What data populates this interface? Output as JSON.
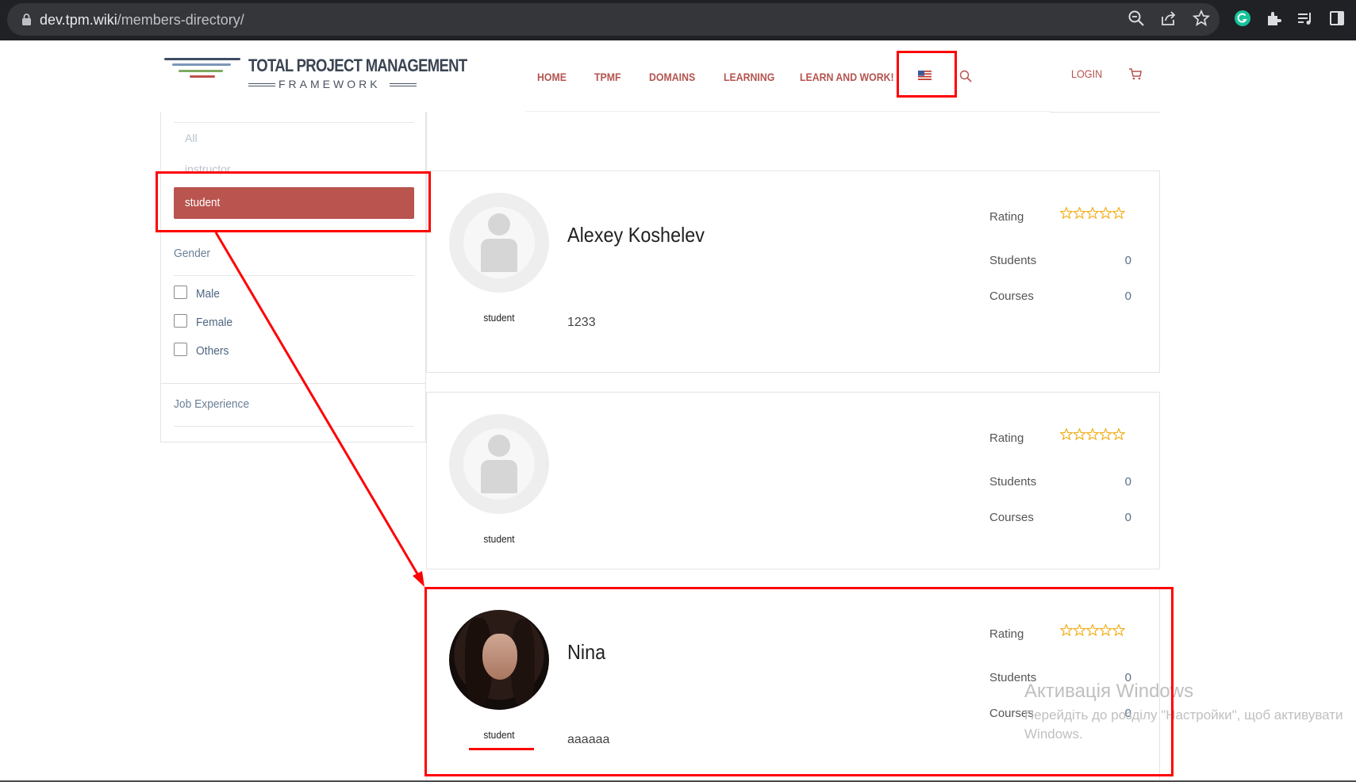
{
  "browser": {
    "url_host": "dev.tpm.wiki",
    "url_path": "/members-directory/"
  },
  "site": {
    "logo_title": "TOTAL PROJECT MANAGEMENT",
    "logo_subtitle": "FRAMEWORK",
    "nav": [
      "HOME",
      "TPMF",
      "DOMAINS",
      "LEARNING",
      "LEARN AND WORK!"
    ],
    "login_label": "LOGIN",
    "accent_color": "#b9544f"
  },
  "sidebar": {
    "roles": [
      "All",
      "instructor",
      "student"
    ],
    "active_role": "student",
    "gender_heading": "Gender",
    "gender_options": [
      "Male",
      "Female",
      "Others"
    ],
    "job_heading": "Job Experience"
  },
  "members": [
    {
      "name": "Alexey Koshelev",
      "role": "student",
      "bio": "1233",
      "rating_label": "Rating",
      "rating": 0,
      "students_label": "Students",
      "students": "0",
      "courses_label": "Courses",
      "courses": "0",
      "avatar": "placeholder"
    },
    {
      "name": "",
      "role": "student",
      "bio": "",
      "rating_label": "Rating",
      "rating": 0,
      "students_label": "Students",
      "students": "0",
      "courses_label": "Courses",
      "courses": "0",
      "avatar": "placeholder"
    },
    {
      "name": "Nina",
      "role": "student",
      "bio": "aaaaaa",
      "rating_label": "Rating",
      "rating": 0,
      "students_label": "Students",
      "students": "0",
      "courses_label": "Courses",
      "courses": "0",
      "avatar": "photo"
    }
  ],
  "watermark": {
    "line1": "Активація Windows",
    "line2": "Перейдіть до розділу \"Настройки\", щоб активувати",
    "line3": "Windows."
  },
  "icons": {
    "chrome": [
      "lock-icon",
      "zoom-icon",
      "share-icon",
      "star-icon",
      "grammarly-icon",
      "extensions-icon",
      "media-icon",
      "sidepanel-icon"
    ],
    "header": [
      "us-flag-icon",
      "search-icon",
      "cart-icon"
    ]
  }
}
